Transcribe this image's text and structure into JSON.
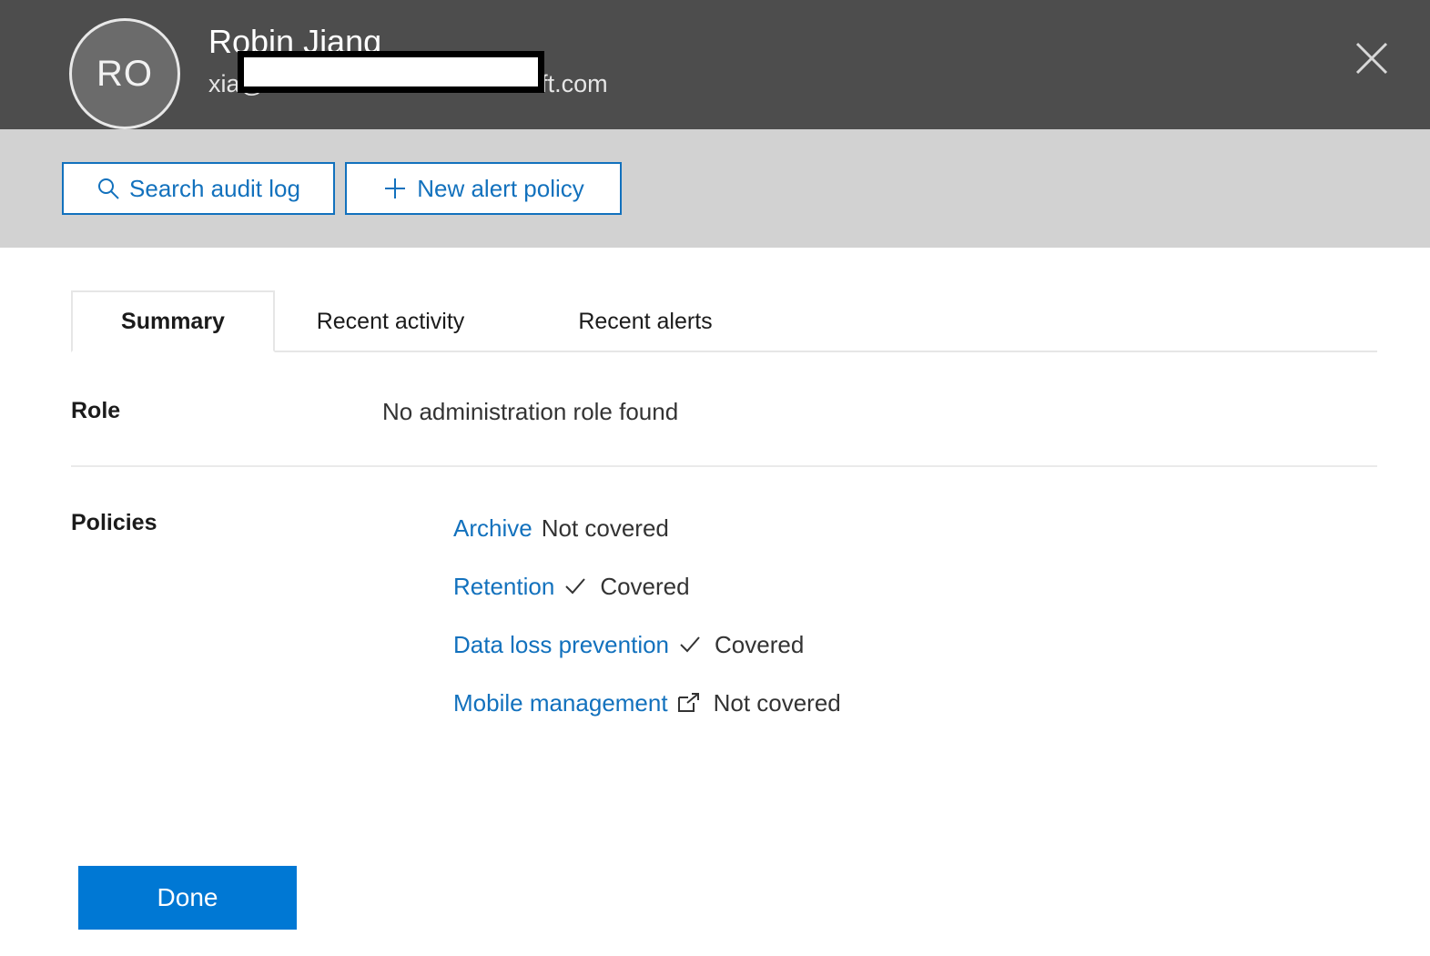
{
  "header": {
    "avatar_initials": "RO",
    "display_name": "Robin Jiang",
    "upn_local_visible": "xia",
    "upn_domain": "@M365x407055.onmicrosoft.com",
    "close_label": "Close",
    "bg_color": "#4d4d4d"
  },
  "commandbar": {
    "bg_color": "#d2d2d2",
    "accent_color": "#1271bd",
    "buttons": [
      {
        "label": "Search audit log",
        "icon": "search-icon"
      },
      {
        "label": "New alert policy",
        "icon": "plus-icon"
      }
    ]
  },
  "tabs": [
    {
      "label": "Summary",
      "active": true
    },
    {
      "label": "Recent activity",
      "active": false
    },
    {
      "label": "Recent alerts",
      "active": false
    }
  ],
  "role": {
    "label": "Role",
    "value": "No administration role found"
  },
  "policies": {
    "label": "Policies",
    "items": [
      {
        "link": "Archive",
        "icon": "none",
        "status": "Not covered"
      },
      {
        "link": "Retention",
        "icon": "checkmark-icon",
        "status": "Covered"
      },
      {
        "link": "Data loss prevention",
        "icon": "checkmark-icon",
        "status": "Covered"
      },
      {
        "link": "Mobile management",
        "icon": "open-in-new-window-icon",
        "status": "Not covered"
      }
    ]
  },
  "footer": {
    "done_label": "Done",
    "done_color": "#0078d4"
  }
}
